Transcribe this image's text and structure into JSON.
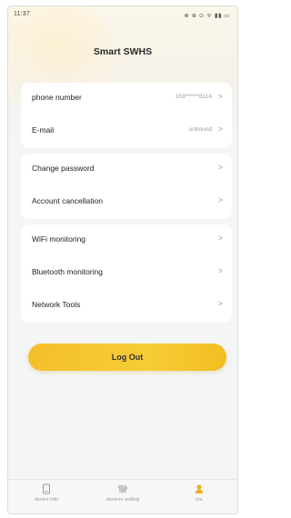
{
  "status_bar": {
    "time": "11:37",
    "icons": "⊗ ⊕ ⊙ ᯤ ▮▮ ▭"
  },
  "header": {
    "title": "Smart SWHS"
  },
  "account_card": [
    {
      "label": "phone number",
      "value": "159******8114"
    },
    {
      "label": "E-mail",
      "value": "unbound"
    }
  ],
  "security_card": [
    {
      "label": "Change password"
    },
    {
      "label": "Account cancellation"
    }
  ],
  "tools_card": [
    {
      "label": "WiFi monitoring"
    },
    {
      "label": "Bluetooth monitoring"
    },
    {
      "label": "Network Tools"
    }
  ],
  "arrow_glyph": ">",
  "logout_label": "Log Out",
  "tabbar": [
    {
      "label": "device info",
      "icon": "device-info-icon",
      "active": false
    },
    {
      "label": "devices setting",
      "icon": "devices-setting-icon",
      "active": false
    },
    {
      "label": "me",
      "icon": "me-icon",
      "active": true
    }
  ],
  "colors": {
    "accent": "#f6c630",
    "active_tab": "#e6b020",
    "inactive_tab": "#9a9a9a"
  }
}
